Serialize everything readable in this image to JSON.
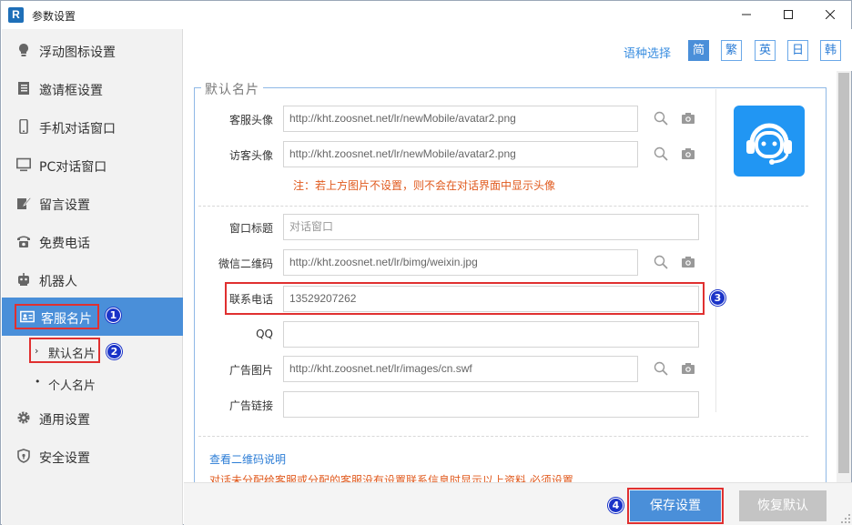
{
  "window": {
    "title": "参数设置",
    "app_icon_letter": "R",
    "controls": [
      "minimize-icon",
      "maximize-icon",
      "close-icon"
    ]
  },
  "sidebar": {
    "items": [
      {
        "label": "浮动图标设置",
        "icon": "lightbulb-icon"
      },
      {
        "label": "邀请框设置",
        "icon": "document-icon"
      },
      {
        "label": "手机对话窗口",
        "icon": "mobile-phone-icon"
      },
      {
        "label": "PC对话窗口",
        "icon": "monitor-icon"
      },
      {
        "label": "留言设置",
        "icon": "edit-note-icon"
      },
      {
        "label": "免费电话",
        "icon": "telephone-icon"
      },
      {
        "label": "机器人",
        "icon": "robot-icon"
      },
      {
        "label": "客服名片",
        "icon": "id-card-icon",
        "active": true
      },
      {
        "label": "通用设置",
        "icon": "gear-icon"
      },
      {
        "label": "安全设置",
        "icon": "shield-icon"
      }
    ],
    "subitems": [
      {
        "label": "默认名片",
        "marker": "›",
        "active": true
      },
      {
        "label": "个人名片",
        "marker": "•"
      }
    ]
  },
  "language": {
    "label": "语种选择",
    "options": [
      "简",
      "繁",
      "英",
      "日",
      "韩"
    ],
    "selected": "简"
  },
  "form": {
    "legend": "默认名片",
    "fields": {
      "agent_avatar": {
        "label": "客服头像",
        "value": "http://kht.zoosnet.net/lr/newMobile/avatar2.png"
      },
      "visitor_avatar": {
        "label": "访客头像",
        "value": "http://kht.zoosnet.net/lr/newMobile/avatar2.png"
      },
      "window_title": {
        "label": "窗口标题",
        "placeholder": "对话窗口"
      },
      "wechat_qr": {
        "label": "微信二维码",
        "value": "http://kht.zoosnet.net/lr/bimg/weixin.jpg"
      },
      "phone": {
        "label": "联系电话",
        "value": "13529207262"
      },
      "qq": {
        "label": "QQ",
        "value": ""
      },
      "ad_image": {
        "label": "广告图片",
        "value": "http://kht.zoosnet.net/lr/images/cn.swf"
      },
      "ad_link": {
        "label": "广告链接",
        "value": ""
      }
    },
    "note": "注：若上方图片不设置，则不会在对话界面中显示头像",
    "qr_help_link": "查看二维码说明",
    "warning": "对话未分配给客服或分配的客服没有设置联系信息时显示以上资料,必须设置",
    "colors": {
      "accent": "#4a8fd9",
      "note": "#e05a1e",
      "link": "#2c7dd6",
      "avatar_bg": "#2196f3"
    }
  },
  "annotations": [
    "1",
    "2",
    "3",
    "4"
  ],
  "footer": {
    "save_label": "保存设置",
    "reset_label": "恢复默认"
  }
}
